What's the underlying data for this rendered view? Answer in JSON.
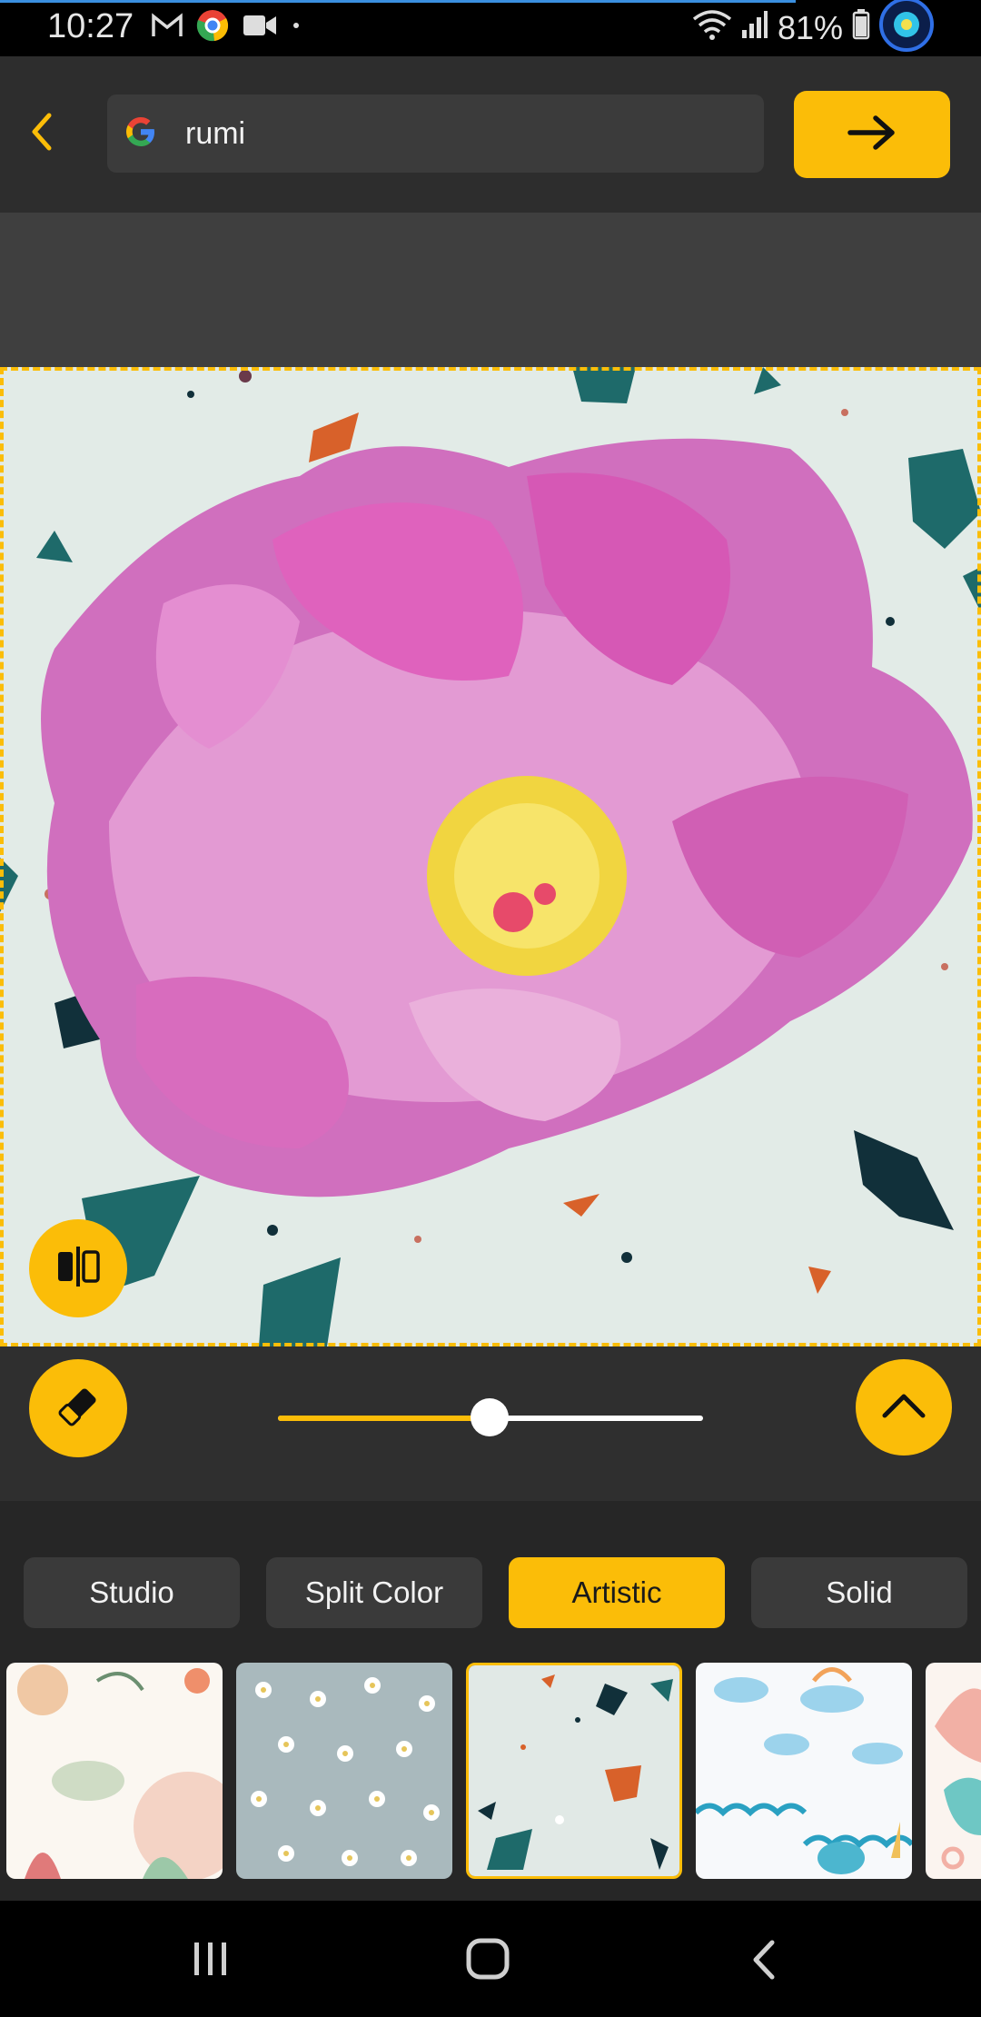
{
  "status_bar": {
    "time": "10:27",
    "battery": "81%",
    "icons": [
      "gmail-icon",
      "chrome-icon",
      "video-camera-icon",
      "dot-icon",
      "wifi-icon",
      "signal-icon",
      "battery-icon",
      "overlay-app-icon"
    ]
  },
  "header": {
    "back_icon": "chevron-left-icon",
    "search_value": "rumi",
    "search_engine_icon": "google-icon",
    "go_icon": "arrow-right-icon"
  },
  "editor": {
    "subject": "pink peony flower on terrazzo background",
    "compare_icon": "compare-split-icon",
    "eraser_icon": "eraser-icon",
    "brush_size_fraction": 0.5,
    "expand_icon": "chevron-up-icon"
  },
  "categories": {
    "tabs": [
      {
        "label": "Studio",
        "active": false
      },
      {
        "label": "Split Color",
        "active": false
      },
      {
        "label": "Artistic",
        "active": true
      },
      {
        "label": "Solid",
        "active": false
      }
    ],
    "thumbnails": [
      {
        "name": "boho-floral-pattern",
        "selected": false
      },
      {
        "name": "daisy-pattern",
        "selected": false
      },
      {
        "name": "terrazzo-pattern",
        "selected": true
      },
      {
        "name": "clouds-waves-pattern",
        "selected": false
      },
      {
        "name": "pastel-rainbow-pattern",
        "selected": false
      }
    ]
  },
  "navbar": {
    "recents_icon": "recents-icon",
    "home_icon": "home-icon",
    "back_icon": "back-icon"
  },
  "colors": {
    "accent": "#fbbd08",
    "background": "#2b2b2b"
  }
}
